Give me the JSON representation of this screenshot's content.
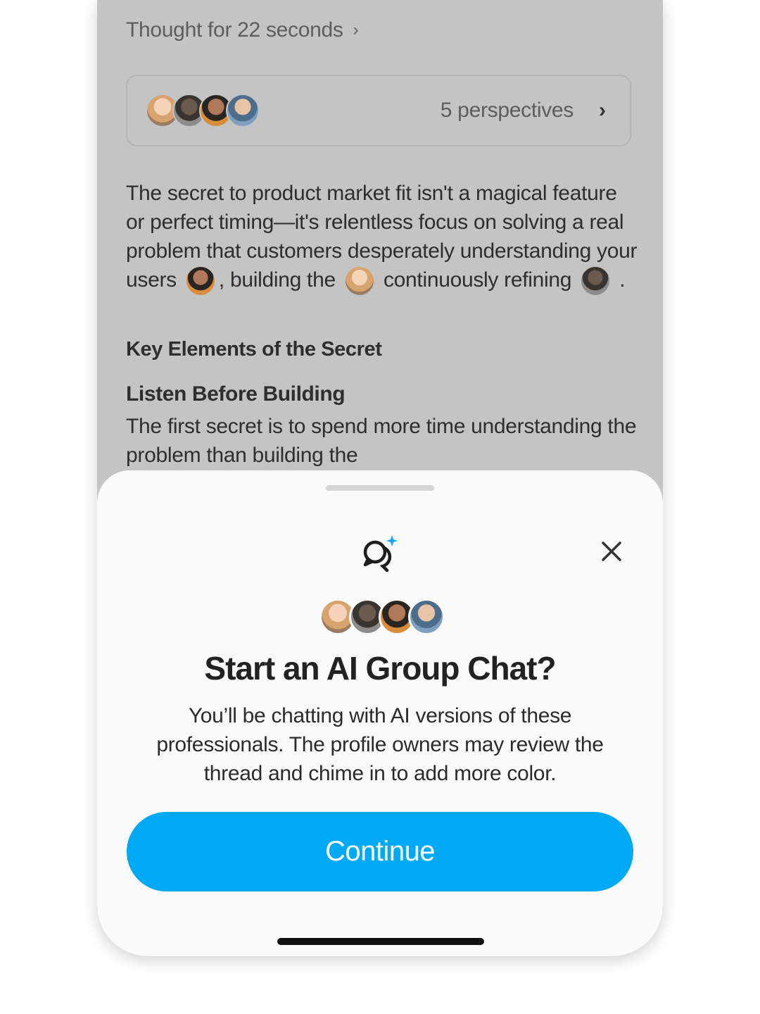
{
  "thread": {
    "thought_label": "Thought for 22 seconds",
    "perspectives_label": "5 perspectives",
    "paragraph_1": {
      "part_a": "The secret to product market fit isn't a magical feature or perfect timing—it's relentless focus on solving a real problem that customers desperately understanding your users",
      "part_b": ", building the",
      "part_c": "continuously refining",
      "part_d": "."
    },
    "heading": "Key Elements of the Secret",
    "subheading": "Listen Before Building",
    "paragraph_2": "The first secret is to spend more time understanding the problem than building the"
  },
  "sheet": {
    "title": "Start an AI Group Chat?",
    "description": "You’ll be chatting with AI versions of these professionals. The profile owners may review the thread and chime in to add more color.",
    "continue_label": "Continue"
  },
  "icons": {
    "chat": "ai-group-chat-icon",
    "close": "close-icon",
    "chevron": "chevron-right-icon"
  },
  "colors": {
    "accent": "#00a9f4",
    "overlay": "#c4c4c4",
    "sheet_bg": "#fafafa",
    "sparkle": "#1aa3f0"
  }
}
